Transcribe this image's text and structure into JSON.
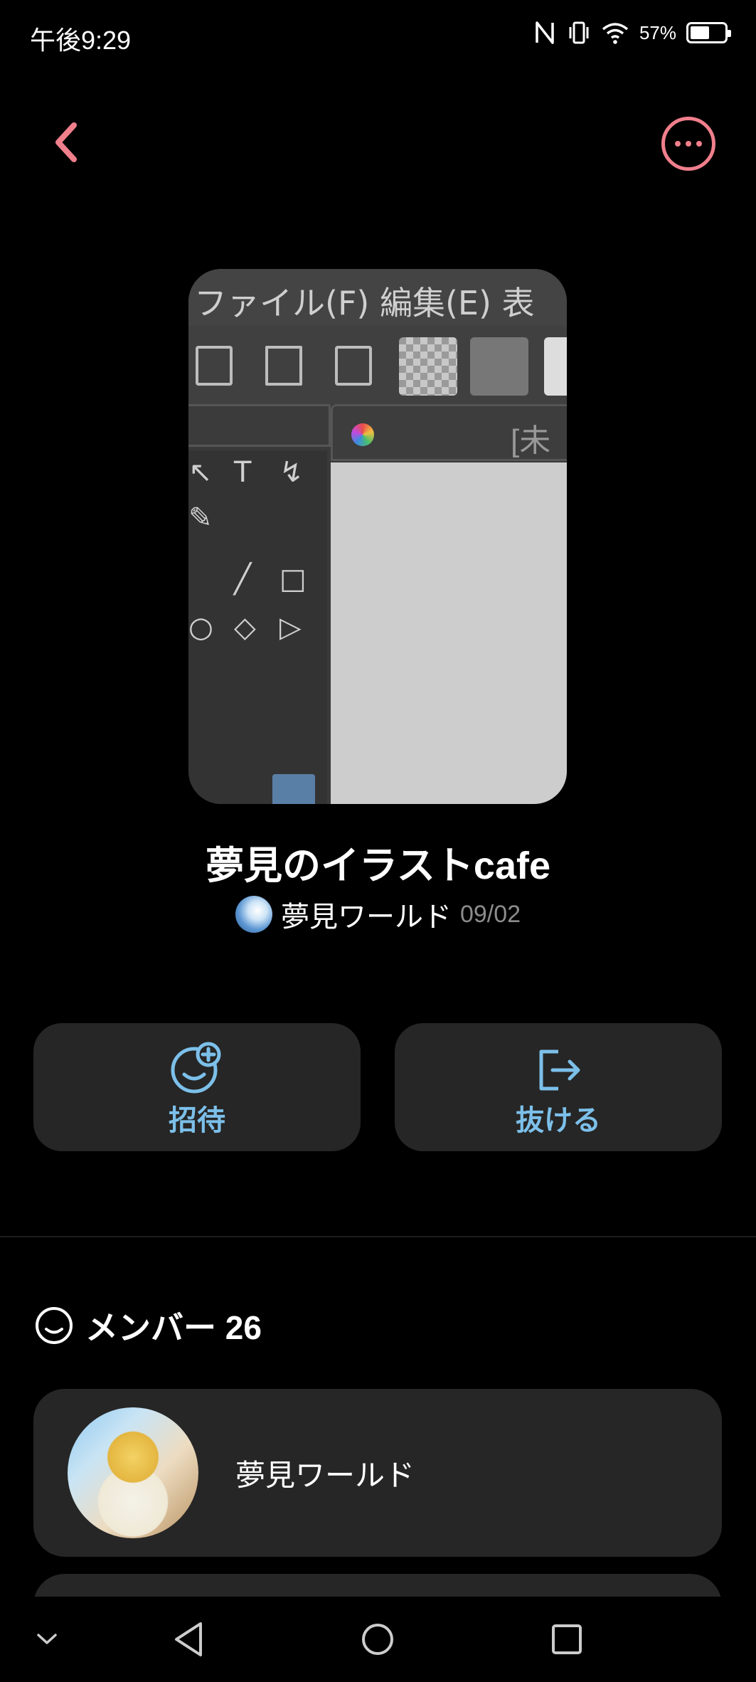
{
  "status_bar": {
    "time": "午後9:29",
    "battery_percent": "57%",
    "battery_level": 0.57,
    "icons": [
      "nfc-icon",
      "vibrate-icon",
      "wifi-icon",
      "battery-icon"
    ]
  },
  "header": {
    "back_icon": "chevron-left-icon",
    "more_icon": "more-horizontal-icon",
    "accent_color": "#f07f8c"
  },
  "cover": {
    "menu_text": "ファイル(F)  編集(E)  表",
    "tab_text": "[未",
    "tools": [
      "↖",
      "T",
      "↯",
      "✎",
      "╱",
      "□",
      "○",
      "◇",
      "▷"
    ]
  },
  "room": {
    "title": "夢見のイラストcafe",
    "owner_name": "夢見ワールド",
    "date": "09/02"
  },
  "actions": {
    "invite_label": "招待",
    "leave_label": "抜ける",
    "accent_color": "#7cc0ea"
  },
  "members": {
    "heading": "メンバー 26",
    "items": [
      {
        "name": "夢見ワールド"
      },
      {
        "name": ""
      }
    ]
  },
  "nav": {
    "icons": [
      "chevron-down-icon",
      "back-triangle-icon",
      "home-circle-icon",
      "recents-square-icon"
    ]
  }
}
